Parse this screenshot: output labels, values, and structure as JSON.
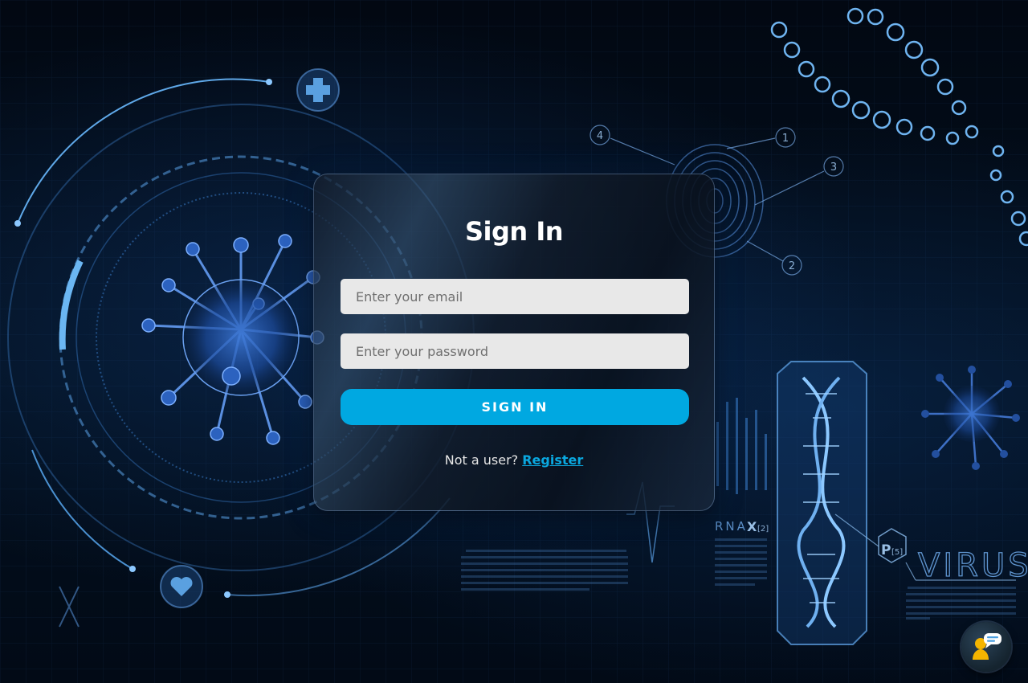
{
  "background": {
    "theme": "biotech virus / DNA illustration",
    "decor_text": {
      "rna_label": "RNA",
      "x_label": "X",
      "x_index": "[2]",
      "p_label": "P",
      "p_index": "[5]",
      "virus_label": "VIRUS",
      "callout_1": "1",
      "callout_2": "2",
      "callout_3": "3",
      "callout_4": "4"
    }
  },
  "signin_form": {
    "title": "Sign In",
    "email": {
      "value": "",
      "placeholder": "Enter your email"
    },
    "password": {
      "value": "",
      "placeholder": "Enter your password"
    },
    "submit_label": "SIGN IN",
    "register_prompt": "Not a user?",
    "register_link": "Register"
  },
  "chat_widget": {
    "icon": "support-chat-icon"
  },
  "colors": {
    "accent": "#00a8e1",
    "link": "#0aa8e0",
    "card_border": "#7896be",
    "input_bg": "#e8e8e8"
  }
}
